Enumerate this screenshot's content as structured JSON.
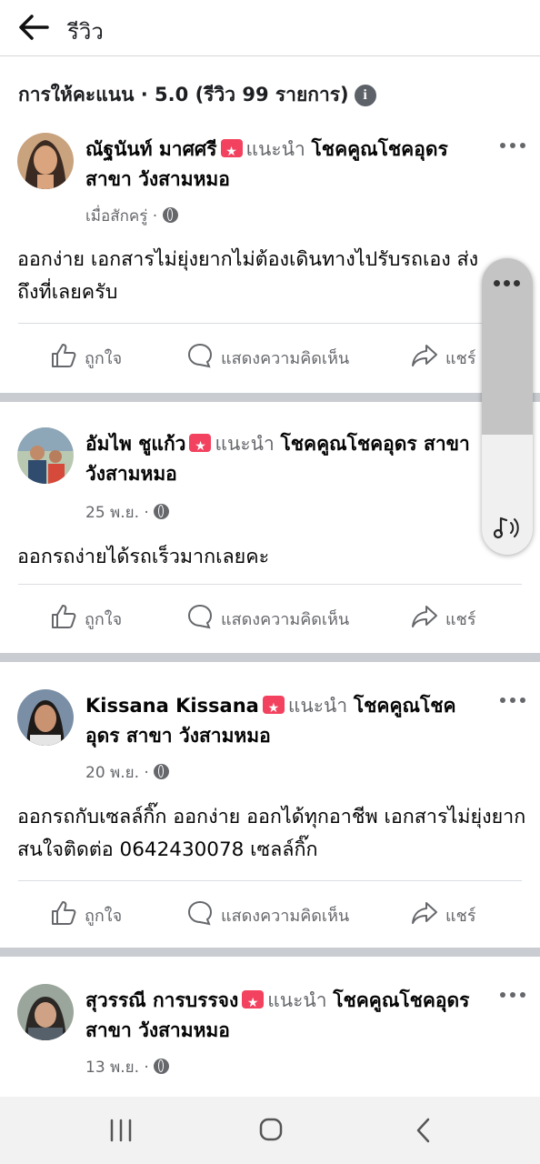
{
  "header": {
    "title": "รีวิว"
  },
  "rating": {
    "summary": "การให้คะแนน · 5.0 (รีวิว 99 รายการ)",
    "info_glyph": "i"
  },
  "actions": {
    "like": "ถูกใจ",
    "comment": "แสดงความคิดเห็น",
    "share": "แชร์"
  },
  "reviews": [
    {
      "name": "ณัฐนันท์ มาศศรี",
      "recommends": "แนะนำ",
      "page": "โชคคูณโชคอุดร สาขา วังสามหมอ",
      "time": "เมื่อสักครู่ ·",
      "text": "ออกง่าย เอกสารไม่ยุ่งยากไม่ต้องเดินทางไปรับรถเอง ส่งถึงที่เลยครับ",
      "share_visible": "แชร์"
    },
    {
      "name": "อัมไพ ชูแก้ว",
      "recommends": "แนะนำ",
      "page": "โชคคูณโชคอุดร สาขา วังสามหมอ",
      "time": "25 พ.ย. ·",
      "text": "ออกรถง่ายได้รถเร็วมากเลยคะ"
    },
    {
      "name": "Kissana Kissana",
      "recommends": "แนะนำ",
      "page": "โชคคูณโชคอุดร สาขา วังสามหมอ",
      "time": "20 พ.ย. ·",
      "text": "ออกรถกับเซลล์กิ๊ก ออกง่าย ออกได้ทุกอาชีพ เอกสารไม่ยุ่งยาก สนใจติดต่อ 0642430078 เซลล์กิ๊ก"
    },
    {
      "name": "สุวรรณี การบรรจง",
      "recommends": "แนะนำ",
      "page": "โชคคูณโชคอุดร สาขา วังสามหมอ",
      "time": "13 พ.ย. ·",
      "text": ""
    }
  ],
  "colors": {
    "accent_badge": "#f3425f",
    "secondary_text": "#65676b",
    "separator": "#c9ccd1",
    "nav_bg": "#f2f2f2"
  },
  "icons": [
    "back-arrow-icon",
    "info-icon",
    "recommend-badge-icon",
    "globe-icon",
    "more-icon",
    "like-icon",
    "comment-icon",
    "share-icon",
    "music-note-icon",
    "recent-apps-icon",
    "home-icon",
    "back-icon"
  ]
}
